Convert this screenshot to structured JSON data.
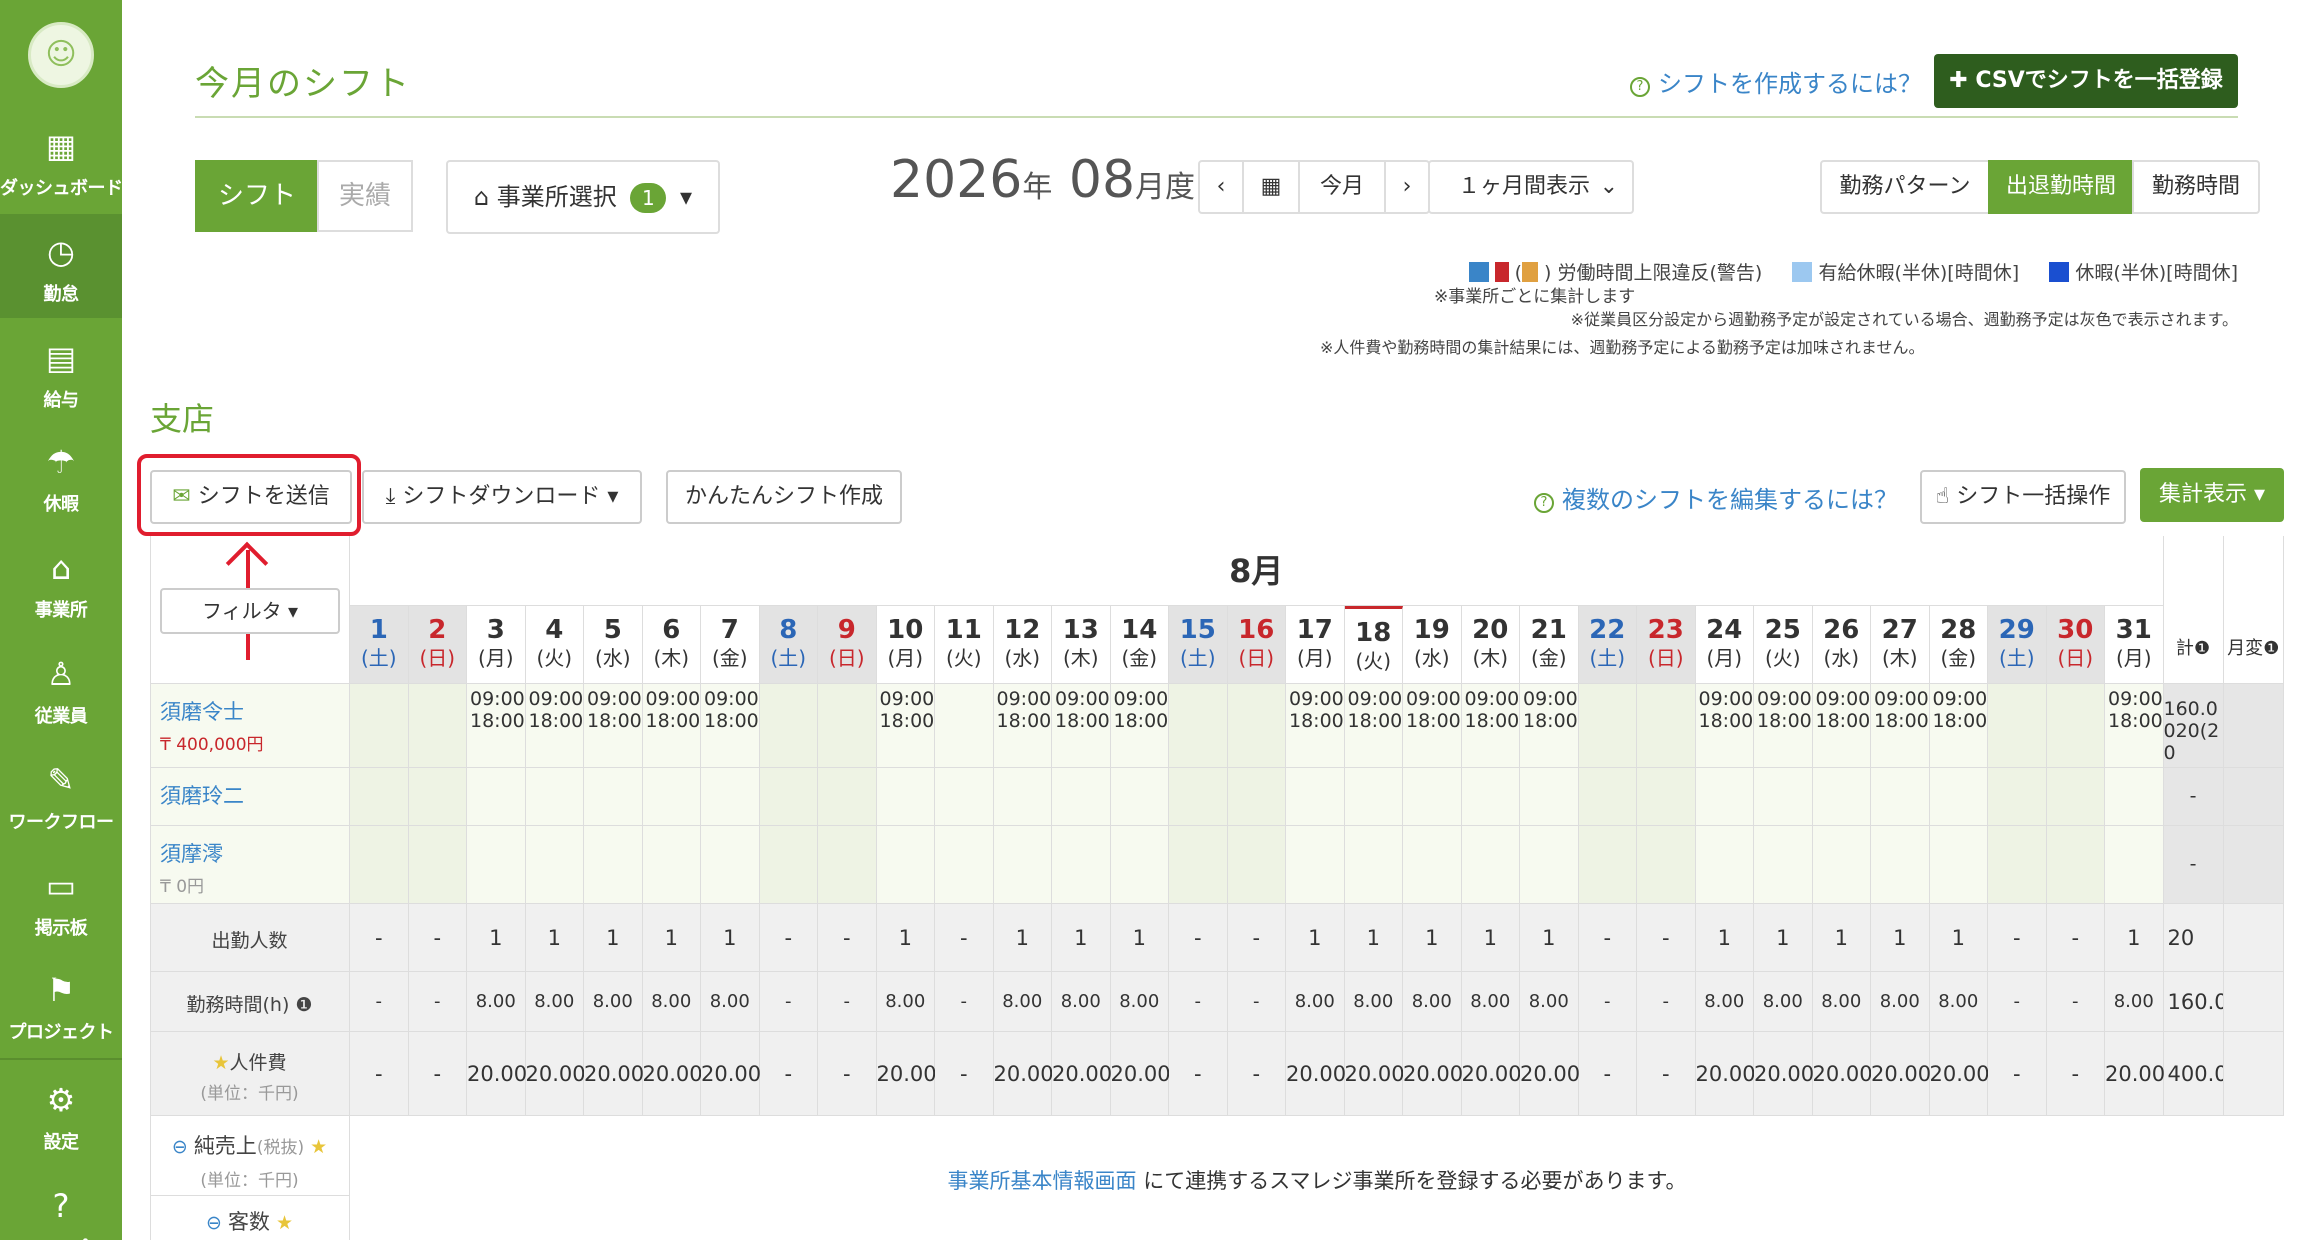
{
  "sidebar": {
    "items": [
      {
        "label": "ダッシュボード"
      },
      {
        "label": "勤怠"
      },
      {
        "label": "給与"
      },
      {
        "label": "休暇"
      },
      {
        "label": "事業所"
      },
      {
        "label": "従業員"
      },
      {
        "label": "ワークフロー"
      },
      {
        "label": "掲示板"
      },
      {
        "label": "プロジェクト"
      },
      {
        "label": "設定"
      },
      {
        "label": "ヘルプ"
      }
    ]
  },
  "header": {
    "title": "今月のシフト",
    "help_link": "シフトを作成するには？",
    "csv_button": "✚ CSVでシフトを一括登録"
  },
  "controls": {
    "tab_shift": "シフト",
    "tab_actual": "実績",
    "office_select": "事業所選択",
    "office_count": "1",
    "year": "2026",
    "year_unit": "年",
    "month": "08",
    "month_unit": "月度",
    "prev": "‹",
    "calendar_icon": "calendar-icon",
    "today": "今月",
    "next": "›",
    "range": "１ヶ月間表示",
    "view_pattern": "勤務パターン",
    "view_inout": "出退勤時間",
    "view_hours": "勤務時間"
  },
  "legend": {
    "item1": "労働時間上限違反(警告)",
    "item1_sub": "※事業所ごとに集計します",
    "item2": "有給休暇(半休)[時間休]",
    "item3": "休暇(半休)[時間休]",
    "note1": "※従業員区分設定から週勤務予定が設定されている場合、週勤務予定は灰色で表示されます。",
    "note2": "※人件費や勤務時間の集計結果には、週勤務予定による勤務予定は加味されません。"
  },
  "branch": "支店",
  "toolbar": {
    "send": "シフトを送信",
    "download": "シフトダウンロード",
    "easy": "かんたんシフト作成",
    "multi_help": "複数のシフトを編集するには？",
    "bulk": "シフト一括操作",
    "aggregate": "集計表示"
  },
  "table": {
    "month_label": "8月",
    "filter": "フィルタ",
    "total_header": "計",
    "monthly_header": "月変",
    "days": [
      {
        "d": "1",
        "w": "土"
      },
      {
        "d": "2",
        "w": "日"
      },
      {
        "d": "3",
        "w": "月"
      },
      {
        "d": "4",
        "w": "火"
      },
      {
        "d": "5",
        "w": "水"
      },
      {
        "d": "6",
        "w": "木"
      },
      {
        "d": "7",
        "w": "金"
      },
      {
        "d": "8",
        "w": "土"
      },
      {
        "d": "9",
        "w": "日"
      },
      {
        "d": "10",
        "w": "月"
      },
      {
        "d": "11",
        "w": "火"
      },
      {
        "d": "12",
        "w": "水"
      },
      {
        "d": "13",
        "w": "木"
      },
      {
        "d": "14",
        "w": "金"
      },
      {
        "d": "15",
        "w": "土"
      },
      {
        "d": "16",
        "w": "日"
      },
      {
        "d": "17",
        "w": "月"
      },
      {
        "d": "18",
        "w": "火"
      },
      {
        "d": "19",
        "w": "水"
      },
      {
        "d": "20",
        "w": "木"
      },
      {
        "d": "21",
        "w": "金"
      },
      {
        "d": "22",
        "w": "土"
      },
      {
        "d": "23",
        "w": "日"
      },
      {
        "d": "24",
        "w": "月"
      },
      {
        "d": "25",
        "w": "火"
      },
      {
        "d": "26",
        "w": "水"
      },
      {
        "d": "27",
        "w": "木"
      },
      {
        "d": "28",
        "w": "金"
      },
      {
        "d": "29",
        "w": "土"
      },
      {
        "d": "30",
        "w": "日"
      },
      {
        "d": "31",
        "w": "月"
      }
    ],
    "employees": [
      {
        "name": "須磨令士",
        "wage": "₸ 400,000円",
        "total": "160.0020(20",
        "shift_days": [
          3,
          4,
          5,
          6,
          7,
          10,
          12,
          13,
          14,
          17,
          18,
          19,
          20,
          21,
          24,
          25,
          26,
          27,
          28,
          31
        ]
      },
      {
        "name": "須磨玲二",
        "wage": "",
        "total": "-",
        "shift_days": []
      },
      {
        "name": "須摩澪",
        "wage": "₸ 0円",
        "total": "-",
        "shift_days": []
      }
    ],
    "shift_start": "09:00",
    "shift_end": "18:00",
    "summary": {
      "attendance_label": "出勤人数",
      "hours_label": "勤務時間(h)",
      "cost_label": "人件費",
      "cost_unit": "(単位：千円)",
      "attendance_total": "20",
      "hours_total": "160.0",
      "cost_total": "400.0",
      "one": "1",
      "hours_val": "8.00",
      "cost_val": "20.00",
      "dash": "-"
    },
    "sales_label": "純売上",
    "sales_tax": "(税抜)",
    "sales_unit": "(単位：千円)",
    "customers_label": "客数",
    "link_text": "事業所基本情報画面",
    "link_suffix": " にて連携するスマレジ事業所を登録する必要があります。"
  }
}
